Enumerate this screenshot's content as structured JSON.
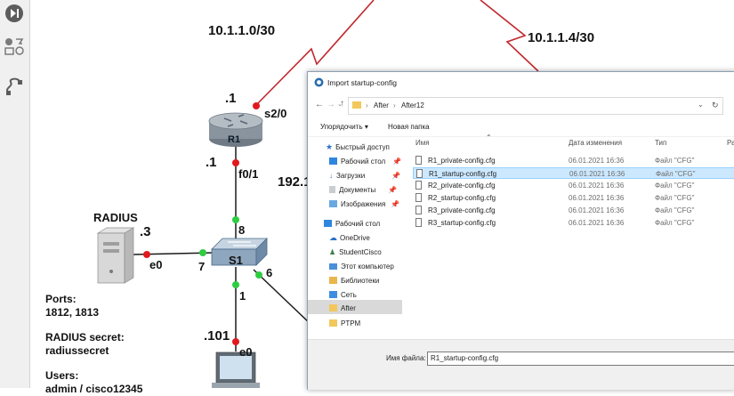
{
  "topology": {
    "subnet_left": "10.1.1.0/30",
    "subnet_right": "10.1.1.4/30",
    "r1_label": "R1",
    "r1_s2_octet": ".1",
    "r1_s2_port": "s2/0",
    "r1_f0_octet": ".1",
    "r1_f0_port": "f0/1",
    "lan_partial": "192.1",
    "radius_label": "RADIUS",
    "radius_octet": ".3",
    "radius_port": "e0",
    "s1_label": "S1",
    "s1_port_radius": "7",
    "s1_port_r1": "8",
    "s1_port_down": "1",
    "s1_port_right": "6",
    "pc_octet": ".101",
    "pc_port": "e0",
    "notes": {
      "ports_title": "Ports:",
      "ports_value": "1812, 1813",
      "secret_title": "RADIUS secret:",
      "secret_value": "radiussecret",
      "users_title": "Users:",
      "users_value": "admin / cisco12345"
    },
    "colors": {
      "link_red": "#c1272d",
      "dot_red": "#e0191f",
      "dot_green": "#2ecc40",
      "wire": "#1a1a1a"
    }
  },
  "dialog": {
    "title": "Import startup-config",
    "breadcrumb": [
      "After",
      "After12"
    ],
    "organize_label": "Упорядочить ▾",
    "new_folder_label": "Новая папка",
    "nav_items": [
      {
        "label": "Быстрый доступ",
        "icon": "star-icon"
      },
      {
        "label": "Рабочий стол",
        "icon": "desktop-icon",
        "pinned": true
      },
      {
        "label": "Загрузки",
        "icon": "download-icon",
        "pinned": true
      },
      {
        "label": "Документы",
        "icon": "documents-icon",
        "pinned": true
      },
      {
        "label": "Изображения",
        "icon": "pictures-icon",
        "pinned": true
      },
      {
        "label": "Рабочий стол",
        "icon": "desktop-icon"
      },
      {
        "label": "OneDrive",
        "icon": "cloud-icon"
      },
      {
        "label": "StudentCisco",
        "icon": "user-icon"
      },
      {
        "label": "Этот компьютер",
        "icon": "computer-icon"
      },
      {
        "label": "Библиотеки",
        "icon": "library-icon"
      },
      {
        "label": "Сеть",
        "icon": "network-icon"
      },
      {
        "label": "After",
        "icon": "folder-icon",
        "selected": true
      },
      {
        "label": "PTPM",
        "icon": "folder-icon"
      }
    ],
    "columns": {
      "name": "Имя",
      "date": "Дата изменения",
      "type": "Тип",
      "size": "Ра"
    },
    "files": [
      {
        "name": "R1_private-config.cfg",
        "date": "06.01.2021 16:36",
        "type": "Файл \"CFG\"",
        "selected": false
      },
      {
        "name": "R1_startup-config.cfg",
        "date": "06.01.2021 16:36",
        "type": "Файл \"CFG\"",
        "selected": true
      },
      {
        "name": "R2_private-config.cfg",
        "date": "06.01.2021 16:36",
        "type": "Файл \"CFG\"",
        "selected": false
      },
      {
        "name": "R2_startup-config.cfg",
        "date": "06.01.2021 16:36",
        "type": "Файл \"CFG\"",
        "selected": false
      },
      {
        "name": "R3_private-config.cfg",
        "date": "06.01.2021 16:36",
        "type": "Файл \"CFG\"",
        "selected": false
      },
      {
        "name": "R3_startup-config.cfg",
        "date": "06.01.2021 16:36",
        "type": "Файл \"CFG\"",
        "selected": false
      }
    ],
    "filename_label": "Имя файла:",
    "filename_value": "R1_startup-config.cfg",
    "colors": {
      "selected_row": "#cce8ff",
      "selected_border": "#99d1ff",
      "nav_selected": "#d9d9d9",
      "folder": "#f2c75c"
    }
  }
}
